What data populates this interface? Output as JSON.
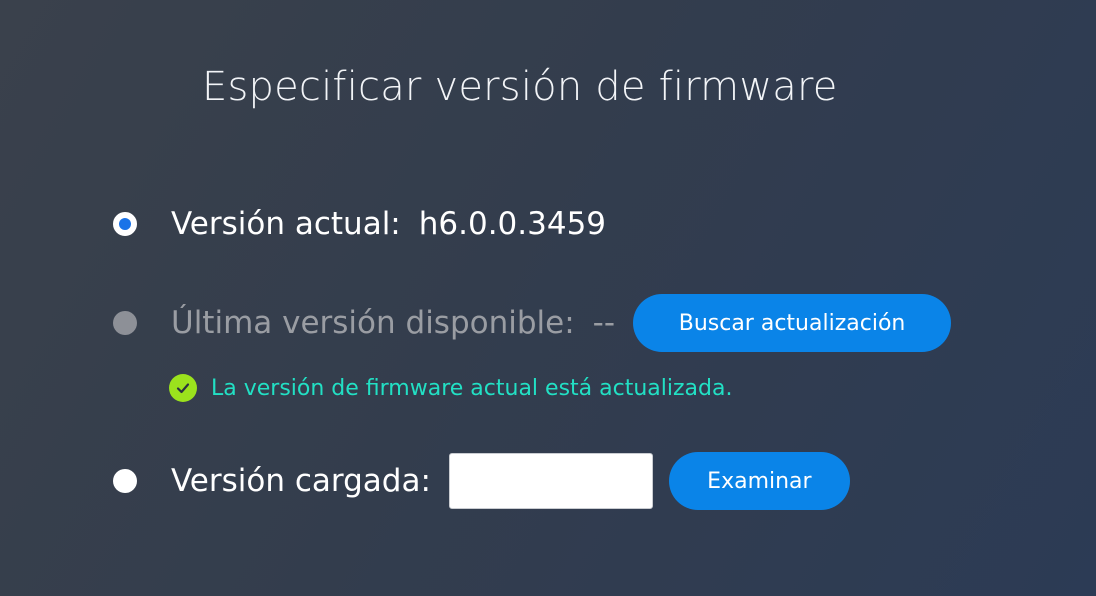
{
  "page": {
    "title": "Especificar versión de firmware"
  },
  "options": {
    "current": {
      "label": "Versión actual:",
      "value": "h6.0.0.3459",
      "selected": true
    },
    "latest": {
      "label": "Última versión disponible:",
      "value": "--",
      "enabled": false,
      "button_label": "Buscar actualización"
    },
    "uploaded": {
      "label": "Versión cargada:",
      "input_value": "",
      "button_label": "Examinar"
    }
  },
  "status": {
    "icon": "check-circle-icon",
    "text": "La versión de firmware actual está actualizada.",
    "color": "#22e0c4",
    "icon_color": "#9be21d"
  },
  "colors": {
    "accent": "#0a84e8",
    "radio_selected": "#1a73e8",
    "muted_text": "#9a9da3"
  }
}
